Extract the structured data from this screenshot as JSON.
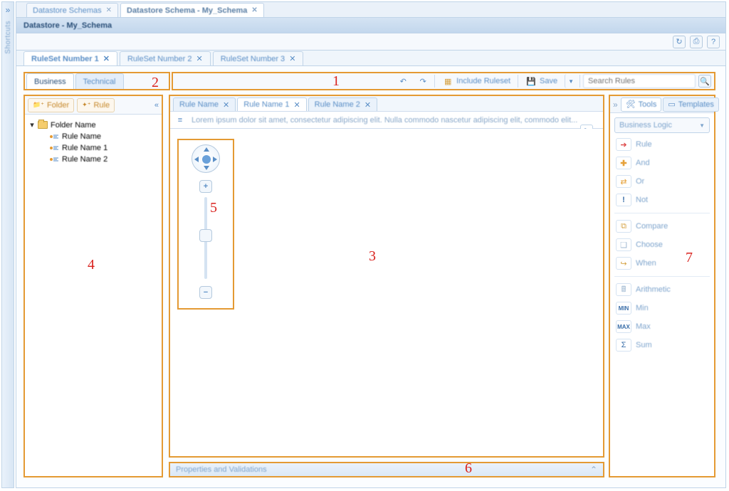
{
  "shortcuts_label": "Shortcuts",
  "doc_tabs": [
    {
      "label": "Datastore Schemas",
      "active": false
    },
    {
      "label": "Datastore Schema - My_Schema",
      "active": true
    }
  ],
  "header_title": "Datastore - My_Schema",
  "top_icons": {
    "refresh": "↻",
    "print": "⎙",
    "help": "?"
  },
  "ruleset_tabs": [
    {
      "label": "RuleSet Number 1",
      "active": true
    },
    {
      "label": "RuleSet Number 2",
      "active": false
    },
    {
      "label": "RuleSet Number 3",
      "active": false
    }
  ],
  "view_tabs": {
    "business": "Business",
    "technical": "Technical"
  },
  "action_bar": {
    "undo": "↶",
    "redo": "↷",
    "include_ruleset": "Include Ruleset",
    "save": "Save",
    "search_placeholder": "Search Rules"
  },
  "left_panel": {
    "new_folder": "Folder",
    "new_rule": "Rule",
    "folder": "Folder Name",
    "rules": [
      "Rule Name",
      "Rule Name 1",
      "Rule Name 2"
    ]
  },
  "center": {
    "tabs": [
      {
        "label": "Rule Name",
        "active": false
      },
      {
        "label": "Rule Name 1",
        "active": true
      },
      {
        "label": "Rule Name 2",
        "active": false
      }
    ],
    "description": "Lorem ipsum dolor sit amet, consectetur adipiscing elit. Nulla commodo nascetur adipiscing elit, commodo elit..."
  },
  "tools": {
    "tab_tools": "Tools",
    "tab_templates": "Templates",
    "category": "Business Logic",
    "items": {
      "rule": "Rule",
      "and": "And",
      "or": "Or",
      "not": "Not",
      "compare": "Compare",
      "choose": "Choose",
      "when": "When",
      "arithmetic": "Arithmetic",
      "min": "Min",
      "max": "Max",
      "sum": "Sum"
    }
  },
  "props_label": "Properties and Validations",
  "annot": {
    "a1": "1",
    "a2": "2",
    "a3": "3",
    "a4": "4",
    "a5": "5",
    "a6": "6",
    "a7": "7"
  }
}
